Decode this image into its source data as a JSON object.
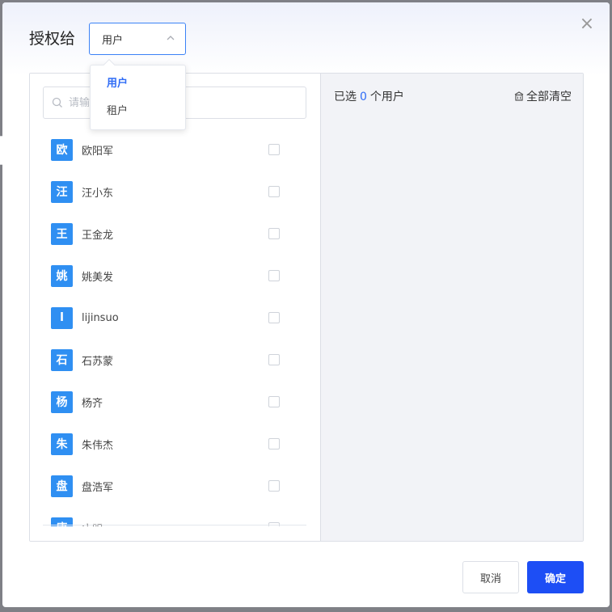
{
  "dialog": {
    "title": "授权给",
    "close_glyph": "×"
  },
  "select": {
    "value": "用户",
    "options": [
      {
        "label": "用户",
        "active": true
      },
      {
        "label": "租户",
        "active": false
      }
    ]
  },
  "search": {
    "placeholder": "请输入"
  },
  "users": [
    {
      "avatar": "欧",
      "name": "欧阳军",
      "checked": false
    },
    {
      "avatar": "汪",
      "name": "汪小东",
      "checked": false
    },
    {
      "avatar": "王",
      "name": "王金龙",
      "checked": false
    },
    {
      "avatar": "姚",
      "name": "姚美发",
      "checked": false
    },
    {
      "avatar": "l",
      "name": "lijinsuo",
      "checked": false
    },
    {
      "avatar": "石",
      "name": "石苏蒙",
      "checked": false
    },
    {
      "avatar": "杨",
      "name": "杨齐",
      "checked": false
    },
    {
      "avatar": "朱",
      "name": "朱伟杰",
      "checked": false
    },
    {
      "avatar": "盘",
      "name": "盘浩军",
      "checked": false
    },
    {
      "avatar": "唐",
      "name": "唐明",
      "checked": false
    }
  ],
  "selected": {
    "prefix": "已选",
    "count": "0",
    "suffix": "个用户",
    "clear_label": "全部清空"
  },
  "footer": {
    "cancel_label": "取消",
    "confirm_label": "确定"
  },
  "colors": {
    "accent": "#1d4ef5",
    "avatar": "#2f8ff2",
    "count": "#2f6cf6"
  },
  "icons": {
    "close": "close-icon",
    "select_arrow": "chevron-up-icon",
    "search": "search-icon",
    "clear": "trash-icon"
  }
}
